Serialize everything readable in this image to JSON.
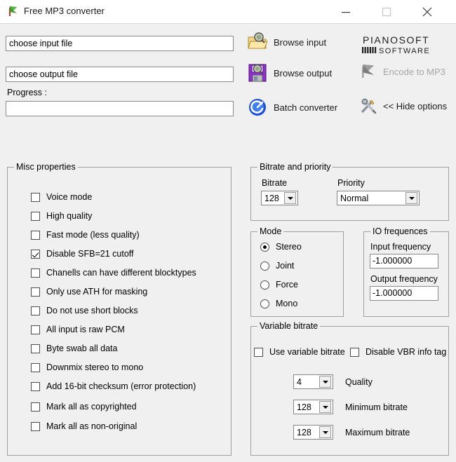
{
  "window": {
    "title": "Free MP3 converter",
    "icon": "app-flag-icon",
    "controls": {
      "minimize": "minimize-icon",
      "maximize": "maximize-icon",
      "close": "close-icon"
    }
  },
  "top": {
    "input_file_value": "choose input file",
    "output_file_value": "choose output file",
    "progress_label": "Progress :",
    "progress_value": "",
    "actions": [
      {
        "label": "Browse input",
        "icon": "folder-open-icon",
        "enabled": true
      },
      {
        "label": "Browse output",
        "icon": "floppy-disk-icon",
        "enabled": true
      },
      {
        "label": "Batch converter",
        "icon": "batch-circle-icon",
        "enabled": true
      },
      {
        "label": "Encode to MP3",
        "icon": "flag-grey-icon",
        "enabled": false
      },
      {
        "label": "<< Hide options",
        "icon": "tools-icon",
        "enabled": true
      }
    ],
    "logo": {
      "line1": "PIANOSOFT",
      "line2": "SOFTWARE"
    }
  },
  "misc": {
    "title": "Misc properties",
    "checkboxes": [
      {
        "label": "Voice mode",
        "checked": false
      },
      {
        "label": "High quality",
        "checked": false
      },
      {
        "label": "Fast mode (less quality)",
        "checked": false
      },
      {
        "label": "Disable SFB=21 cutoff",
        "checked": true
      },
      {
        "label": "Chanells can have different blocktypes",
        "checked": false
      },
      {
        "label": "Only use ATH for masking",
        "checked": false
      },
      {
        "label": "Do not use short blocks",
        "checked": false
      },
      {
        "label": "All input is raw PCM",
        "checked": false
      },
      {
        "label": "Byte swab all data",
        "checked": false
      },
      {
        "label": "Downmix stereo to mono",
        "checked": false
      },
      {
        "label": "Add 16-bit checksum (error protection)",
        "checked": false
      },
      {
        "label": "Mark all as copyrighted",
        "checked": false
      },
      {
        "label": "Mark all as non-original",
        "checked": false
      }
    ]
  },
  "bitrate_priority": {
    "title": "Bitrate and priority",
    "bitrate_label": "Bitrate",
    "bitrate_value": "128",
    "priority_label": "Priority",
    "priority_value": "Normal"
  },
  "mode": {
    "title": "Mode",
    "options": [
      {
        "label": "Stereo",
        "selected": true
      },
      {
        "label": "Joint",
        "selected": false
      },
      {
        "label": "Force",
        "selected": false
      },
      {
        "label": "Mono",
        "selected": false
      }
    ]
  },
  "io_frequences": {
    "title": "IO frequences",
    "input_label": "Input frequency",
    "input_value": "-1.000000",
    "output_label": "Output frequency",
    "output_value": "-1.000000"
  },
  "variable_bitrate": {
    "title": "Variable bitrate",
    "use_vbr_label": "Use variable bitrate",
    "use_vbr_checked": false,
    "disable_tag_label": "Disable VBR info tag",
    "disable_tag_checked": false,
    "rows": [
      {
        "value": "4",
        "label": "Quality"
      },
      {
        "value": "128",
        "label": "Minimum bitrate"
      },
      {
        "value": "128",
        "label": "Maximum bitrate"
      }
    ]
  },
  "colors": {
    "window_bg": "#f0f0f0",
    "titlebar_bg": "#ffffff",
    "field_bg": "#ffffff",
    "border": "#a0a0a0",
    "disabled_text": "#a6a6a6",
    "logo_dark": "#1e1e1e"
  }
}
